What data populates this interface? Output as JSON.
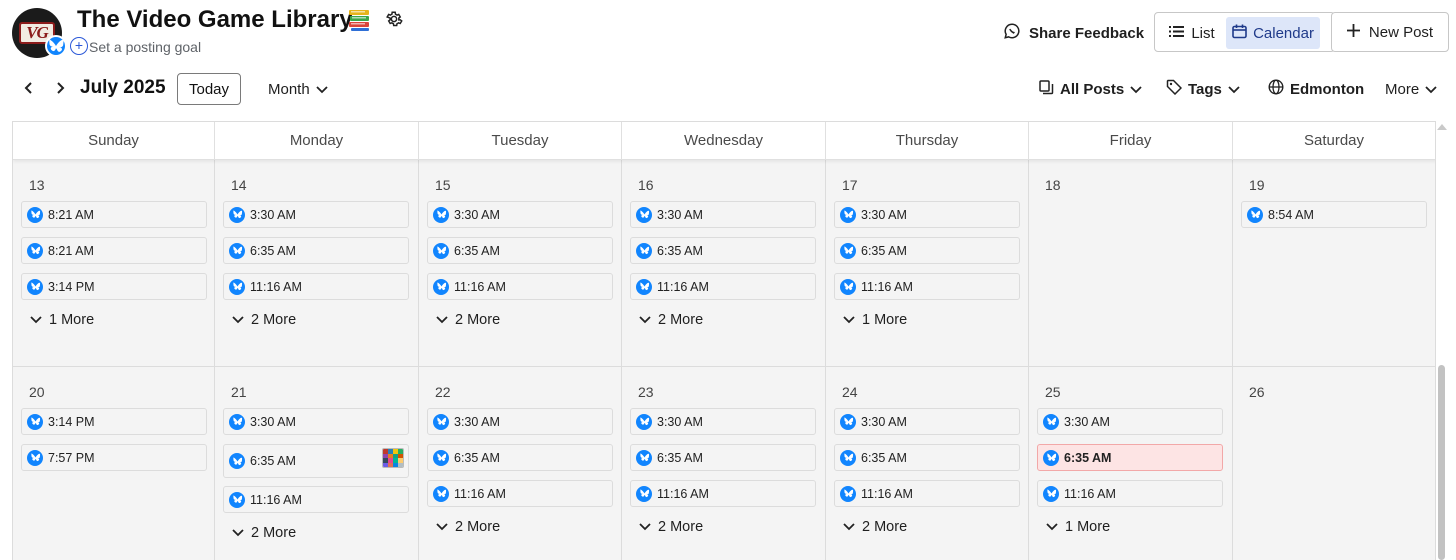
{
  "header": {
    "title": "The Video Game Library",
    "goal_text": "Set a posting goal",
    "avatar_text": "VG",
    "share_feedback": "Share Feedback",
    "view_list": "List",
    "view_calendar": "Calendar",
    "new_post": "New Post"
  },
  "toolbar": {
    "month_label": "July 2025",
    "today": "Today",
    "view_mode": "Month",
    "all_posts": "All Posts",
    "tags": "Tags",
    "timezone": "Edmonton",
    "more": "More"
  },
  "calendar": {
    "weekdays": [
      "Sunday",
      "Monday",
      "Tuesday",
      "Wednesday",
      "Thursday",
      "Friday",
      "Saturday"
    ],
    "weeks": [
      [
        {
          "day": "13",
          "posts": [
            "8:21 AM",
            "8:21 AM",
            "3:14 PM"
          ],
          "more": "1 More"
        },
        {
          "day": "14",
          "posts": [
            "3:30 AM",
            "6:35 AM",
            "11:16 AM"
          ],
          "more": "2 More"
        },
        {
          "day": "15",
          "posts": [
            "3:30 AM",
            "6:35 AM",
            "11:16 AM"
          ],
          "more": "2 More"
        },
        {
          "day": "16",
          "posts": [
            "3:30 AM",
            "6:35 AM",
            "11:16 AM"
          ],
          "more": "2 More"
        },
        {
          "day": "17",
          "posts": [
            "3:30 AM",
            "6:35 AM",
            "11:16 AM"
          ],
          "more": "1 More"
        },
        {
          "day": "18",
          "posts": [],
          "more": ""
        },
        {
          "day": "19",
          "posts": [
            "8:54 AM"
          ],
          "more": ""
        }
      ],
      [
        {
          "day": "20",
          "posts": [
            "3:14 PM",
            "7:57 PM"
          ],
          "more": ""
        },
        {
          "day": "21",
          "posts": [
            "3:30 AM",
            "6:35 AM",
            "11:16 AM"
          ],
          "more": "2 More",
          "thumb_on": 1
        },
        {
          "day": "22",
          "posts": [
            "3:30 AM",
            "6:35 AM",
            "11:16 AM"
          ],
          "more": "2 More"
        },
        {
          "day": "23",
          "posts": [
            "3:30 AM",
            "6:35 AM",
            "11:16 AM"
          ],
          "more": "2 More"
        },
        {
          "day": "24",
          "posts": [
            "3:30 AM",
            "6:35 AM",
            "11:16 AM"
          ],
          "more": "2 More"
        },
        {
          "day": "25",
          "posts": [
            "3:30 AM",
            "6:35 AM",
            "11:16 AM"
          ],
          "more": "1 More",
          "highlight_on": 1
        },
        {
          "day": "26",
          "posts": [],
          "more": ""
        }
      ]
    ]
  },
  "colors": {
    "bluesky": "#1185fe",
    "calendar_active_bg": "#dde6f9",
    "highlight_bg": "#fde4e4",
    "cell_bg": "#f4f4f4"
  },
  "icons": [
    "avatar-logo",
    "bluesky-icon",
    "add-goal-icon",
    "books-icon",
    "gear-icon",
    "feedback-icon",
    "list-icon",
    "calendar-icon",
    "plus-icon",
    "chevron-left-icon",
    "chevron-right-icon",
    "chevron-down-icon",
    "posts-icon",
    "tag-icon",
    "globe-icon"
  ]
}
